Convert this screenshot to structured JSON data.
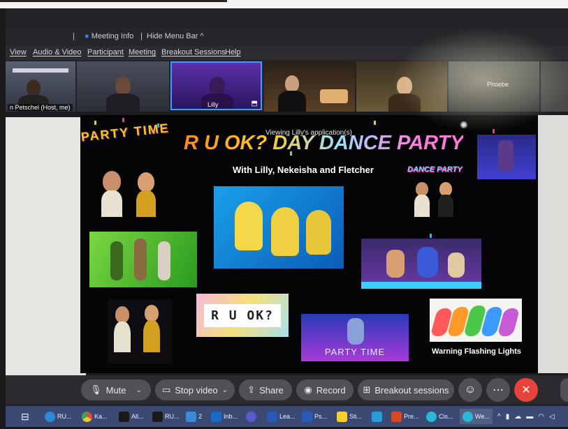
{
  "header": {
    "meeting_info": "Meeting Info",
    "hide_menu_bar": "Hide Menu Bar ^",
    "separator": "|"
  },
  "menu": [
    "View",
    "Audio & Video",
    "Participant",
    "Meeting",
    "Breakout Sessions",
    "Help"
  ],
  "participants": [
    {
      "label": "n Petschel (Host, me)"
    },
    {
      "label": ""
    },
    {
      "label": "Lilly"
    },
    {
      "label": ""
    },
    {
      "label": ""
    },
    {
      "label": "Phoebe"
    }
  ],
  "share": {
    "viewing": "Viewing Lilly's application(s)",
    "title_party_time": "PARTY TIME",
    "title_main": "R U OK? DAY DANCE PARTY!!",
    "subtitle": "With Lilly, Nekeisha and Fletcher",
    "dance_party": "DANCE PARTY",
    "ruok_tile": "R U OK?",
    "party_time_tile": "PARTY TIME",
    "warning": "Warning Flashing Lights"
  },
  "controls": {
    "mute": "Mute",
    "stop_video": "Stop video",
    "share": "Share",
    "record": "Record",
    "breakout": "Breakout sessions"
  },
  "taskbar": [
    "RU...",
    "Ka...",
    "All...",
    "RU...",
    "2",
    "Inb...",
    "Lea...",
    "Ps...",
    "Sti...",
    "Pre...",
    "Cis...",
    "We..."
  ],
  "colors": {
    "accent_blue": "#2e8bff",
    "leave_red": "#e8423a",
    "taskbar": "#3a4a72"
  }
}
